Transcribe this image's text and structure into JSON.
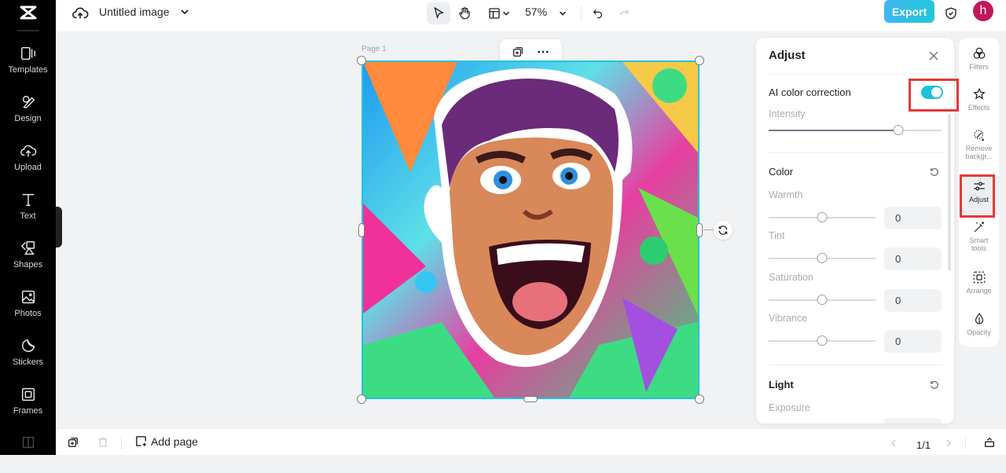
{
  "app": {
    "title": "Untitled image"
  },
  "left_rail": {
    "items": [
      {
        "label": "Templates",
        "icon": "templates-icon"
      },
      {
        "label": "Design",
        "icon": "design-icon"
      },
      {
        "label": "Upload",
        "icon": "upload-icon"
      },
      {
        "label": "Text",
        "icon": "text-icon"
      },
      {
        "label": "Shapes",
        "icon": "shapes-icon"
      },
      {
        "label": "Photos",
        "icon": "photos-icon"
      },
      {
        "label": "Stickers",
        "icon": "stickers-icon"
      },
      {
        "label": "Frames",
        "icon": "frames-icon"
      }
    ]
  },
  "toolbar": {
    "zoom": "57%",
    "export_label": "Export",
    "avatar_initial": "h"
  },
  "canvas": {
    "page_label": "Page 1"
  },
  "adjust_panel": {
    "title": "Adjust",
    "ai_color_correction": {
      "label": "AI color correction",
      "enabled": true
    },
    "intensity": {
      "label": "Intensity",
      "value_fraction": 0.75
    },
    "color": {
      "title": "Color",
      "sliders": [
        {
          "label": "Warmth",
          "value": "0",
          "fraction": 0.5
        },
        {
          "label": "Tint",
          "value": "0",
          "fraction": 0.5
        },
        {
          "label": "Saturation",
          "value": "0",
          "fraction": 0.5
        },
        {
          "label": "Vibrance",
          "value": "0",
          "fraction": 0.5
        }
      ]
    },
    "light": {
      "title": "Light",
      "first_slider_label": "Exposure"
    }
  },
  "right_rail": {
    "items": [
      {
        "label": "Filters"
      },
      {
        "label": "Effects"
      },
      {
        "label": "Remove backgr..."
      },
      {
        "label": "Adjust"
      },
      {
        "label": "Smart tools"
      },
      {
        "label": "Arrange"
      },
      {
        "label": "Opacity"
      }
    ]
  },
  "bottom_bar": {
    "add_page_label": "Add page",
    "page_indicator": "1/1"
  },
  "colors": {
    "accent": "#1ec3d8",
    "highlight_box": "#e53935",
    "avatar": "#c2185b"
  }
}
